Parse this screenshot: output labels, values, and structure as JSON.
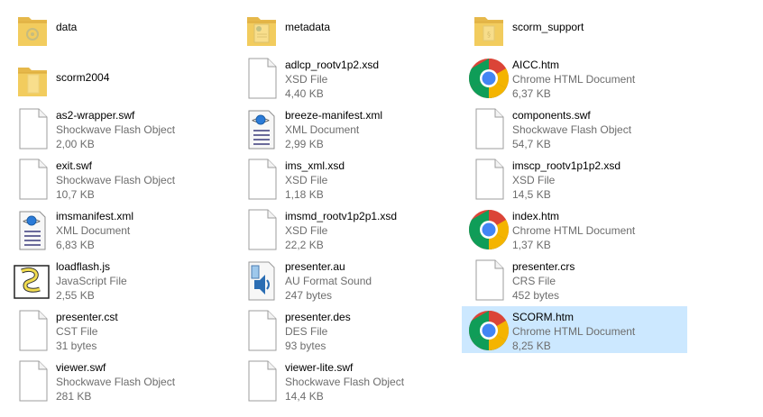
{
  "view": "Tiles",
  "files": [
    {
      "name": "data",
      "type": "",
      "size": "",
      "icon": "folder-icon"
    },
    {
      "name": "metadata",
      "type": "",
      "size": "",
      "icon": "folder-icon"
    },
    {
      "name": "scorm_support",
      "type": "",
      "size": "",
      "icon": "folder-icon"
    },
    {
      "name": "scorm2004",
      "type": "",
      "size": "",
      "icon": "folder-icon"
    },
    {
      "name": "adlcp_rootv1p2.xsd",
      "type": "XSD File",
      "size": "4,40 KB",
      "icon": "blank-file-icon"
    },
    {
      "name": "AICC.htm",
      "type": "Chrome HTML Document",
      "size": "6,37 KB",
      "icon": "chrome-icon"
    },
    {
      "name": "as2-wrapper.swf",
      "type": "Shockwave Flash Object",
      "size": "2,00 KB",
      "icon": "blank-file-icon"
    },
    {
      "name": "breeze-manifest.xml",
      "type": "XML Document",
      "size": "2,99 KB",
      "icon": "xml-file-icon"
    },
    {
      "name": "components.swf",
      "type": "Shockwave Flash Object",
      "size": "54,7 KB",
      "icon": "blank-file-icon"
    },
    {
      "name": "exit.swf",
      "type": "Shockwave Flash Object",
      "size": "10,7 KB",
      "icon": "blank-file-icon"
    },
    {
      "name": "ims_xml.xsd",
      "type": "XSD File",
      "size": "1,18 KB",
      "icon": "blank-file-icon"
    },
    {
      "name": "imscp_rootv1p1p2.xsd",
      "type": "XSD File",
      "size": "14,5 KB",
      "icon": "blank-file-icon"
    },
    {
      "name": "imsmanifest.xml",
      "type": "XML Document",
      "size": "6,83 KB",
      "icon": "xml-file-icon"
    },
    {
      "name": "imsmd_rootv1p2p1.xsd",
      "type": "XSD File",
      "size": "22,2 KB",
      "icon": "blank-file-icon"
    },
    {
      "name": "index.htm",
      "type": "Chrome HTML Document",
      "size": "1,37 KB",
      "icon": "chrome-icon"
    },
    {
      "name": "loadflash.js",
      "type": "JavaScript File",
      "size": "2,55 KB",
      "icon": "js-file-icon"
    },
    {
      "name": "presenter.au",
      "type": "AU Format Sound",
      "size": "247 bytes",
      "icon": "audio-file-icon"
    },
    {
      "name": "presenter.crs",
      "type": "CRS File",
      "size": "452 bytes",
      "icon": "blank-file-icon"
    },
    {
      "name": "presenter.cst",
      "type": "CST File",
      "size": "31 bytes",
      "icon": "blank-file-icon"
    },
    {
      "name": "presenter.des",
      "type": "DES File",
      "size": "93 bytes",
      "icon": "blank-file-icon"
    },
    {
      "name": "SCORM.htm",
      "type": "Chrome HTML Document",
      "size": "8,25 KB",
      "icon": "chrome-icon",
      "selected": true
    },
    {
      "name": "viewer.swf",
      "type": "Shockwave Flash Object",
      "size": "281 KB",
      "icon": "blank-file-icon"
    },
    {
      "name": "viewer-lite.swf",
      "type": "Shockwave Flash Object",
      "size": "14,4 KB",
      "icon": "blank-file-icon"
    }
  ],
  "colors": {
    "selection": "#cce8ff",
    "secondary_text": "#6d6d6d",
    "folder": "#f6d365"
  }
}
